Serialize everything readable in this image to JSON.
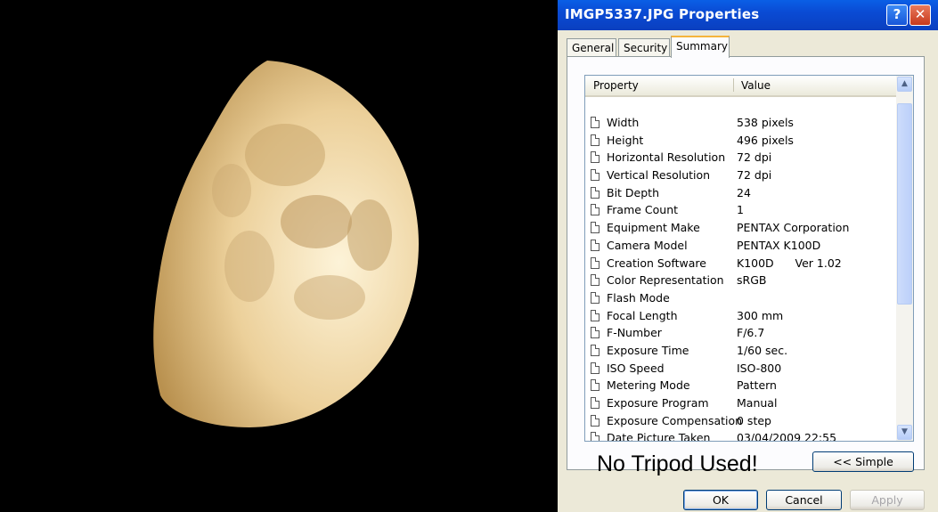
{
  "window": {
    "title": "IMGP5337.JPG Properties"
  },
  "titlebar": {
    "help_label": "?",
    "close_label": "✕"
  },
  "tabs": [
    {
      "label": "General"
    },
    {
      "label": "Security"
    },
    {
      "label": "Summary"
    }
  ],
  "list": {
    "headers": {
      "property": "Property",
      "value": "Value"
    },
    "rows": [
      {
        "property": "Width",
        "value": "538 pixels"
      },
      {
        "property": "Height",
        "value": "496 pixels"
      },
      {
        "property": "Horizontal Resolution",
        "value": "72 dpi"
      },
      {
        "property": "Vertical Resolution",
        "value": "72 dpi"
      },
      {
        "property": "Bit Depth",
        "value": "24"
      },
      {
        "property": "Frame Count",
        "value": "1"
      },
      {
        "property": "Equipment Make",
        "value": "PENTAX Corporation"
      },
      {
        "property": "Camera Model",
        "value": "PENTAX K100D"
      },
      {
        "property": "Creation Software",
        "value": "K100D      Ver 1.02"
      },
      {
        "property": "Color Representation",
        "value": "sRGB"
      },
      {
        "property": "Flash Mode",
        "value": ""
      },
      {
        "property": "Focal Length",
        "value": "300 mm"
      },
      {
        "property": "F-Number",
        "value": "F/6.7"
      },
      {
        "property": "Exposure Time",
        "value": "1/60 sec."
      },
      {
        "property": "ISO Speed",
        "value": "ISO-800"
      },
      {
        "property": "Metering Mode",
        "value": "Pattern"
      },
      {
        "property": "Exposure Program",
        "value": "Manual"
      },
      {
        "property": "Exposure Compensation",
        "value": "0 step"
      },
      {
        "property": "Date Picture Taken",
        "value": "03/04/2009 22:55"
      }
    ]
  },
  "caption": "No Tripod Used!",
  "buttons": {
    "simple": "<< Simple",
    "ok": "OK",
    "cancel": "Cancel",
    "apply": "Apply"
  },
  "colors": {
    "moon_light": "#fdf2d4",
    "moon_mid": "#e8c890",
    "moon_dark": "#b58d4f",
    "titlebar": "#0a4bd4"
  }
}
